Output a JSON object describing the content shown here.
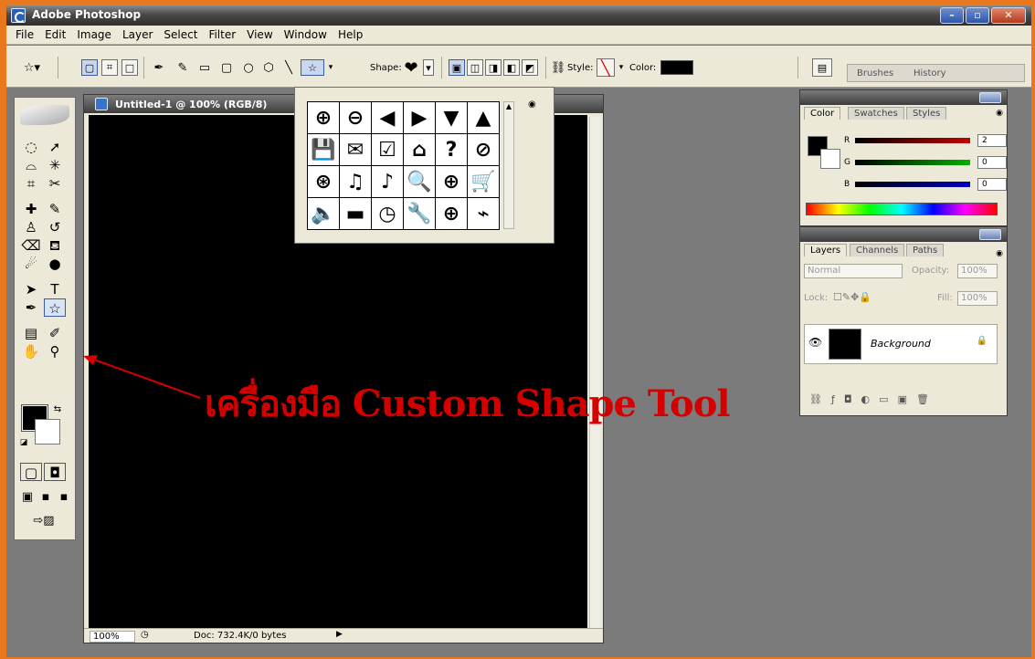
{
  "window": {
    "title": "Adobe Photoshop",
    "minimize": "–",
    "restore": "▫",
    "close": "✕"
  },
  "menu": [
    "File",
    "Edit",
    "Image",
    "Layer",
    "Select",
    "Filter",
    "View",
    "Window",
    "Help"
  ],
  "options_bar": {
    "shape_label": "Shape:",
    "style_label": "Style:",
    "color_label": "Color:",
    "color_value": "#000000",
    "tabs": [
      "Brushes",
      "History"
    ]
  },
  "document": {
    "title": "Untitled-1 @ 100% (RGB/8)",
    "zoom": "100%",
    "doc_info": "Doc: 732.4K/0 bytes"
  },
  "shape_picker": {
    "shapes": [
      "⊕",
      "⊖",
      "◀",
      "▶",
      "▼",
      "▲",
      "💾",
      "✉",
      "☑",
      "⌂",
      "?",
      "⊘",
      "⊛",
      "♫",
      "♪",
      "🔍",
      "⊕",
      "🛒",
      "🔈",
      "▬",
      "◷",
      "🔧",
      "⊕",
      "⌁"
    ]
  },
  "color_panel": {
    "tabs": [
      "Color",
      "Swatches",
      "Styles"
    ],
    "channels": [
      {
        "label": "R",
        "value": "2",
        "color": "#c00000"
      },
      {
        "label": "G",
        "value": "0",
        "color": "#00b000"
      },
      {
        "label": "B",
        "value": "0",
        "color": "#0000c0"
      }
    ]
  },
  "layers_panel": {
    "tabs": [
      "Layers",
      "Channels",
      "Paths"
    ],
    "blend_mode": "Normal",
    "opacity_label": "Opacity:",
    "opacity_value": "100%",
    "lock_label": "Lock:",
    "fill_label": "Fill:",
    "fill_value": "100%",
    "layer_name": "Background"
  },
  "annotation": {
    "text": "เครื่องมือ Custom Shape Tool",
    "color": "#d40000"
  },
  "foreground_color": "#000000",
  "background_color": "#ffffff"
}
